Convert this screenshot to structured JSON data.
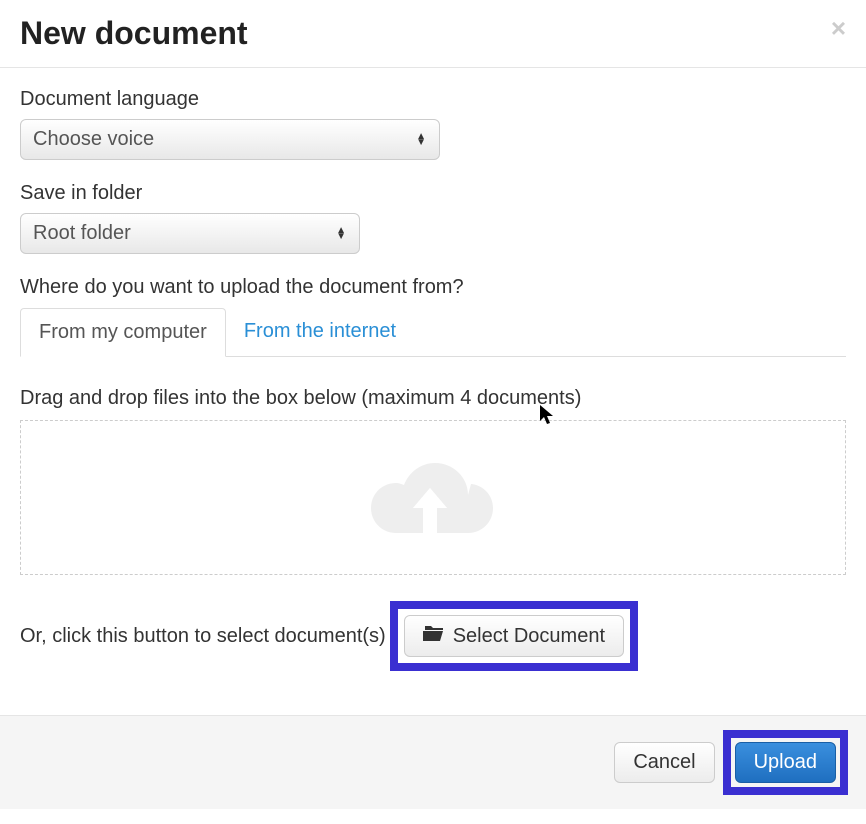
{
  "header": {
    "title": "New document"
  },
  "language": {
    "label": "Document language",
    "selected": "Choose voice"
  },
  "folder": {
    "label": "Save in folder",
    "selected": "Root folder"
  },
  "upload_source": {
    "label": "Where do you want to upload the document from?",
    "tabs": [
      {
        "label": "From my computer"
      },
      {
        "label": "From the internet"
      }
    ]
  },
  "dropzone": {
    "label": "Drag and drop files into the box below (maximum 4 documents)"
  },
  "select_doc": {
    "prompt": "Or, click this button to select document(s)",
    "button_label": "Select Document"
  },
  "footer": {
    "cancel_label": "Cancel",
    "upload_label": "Upload"
  }
}
